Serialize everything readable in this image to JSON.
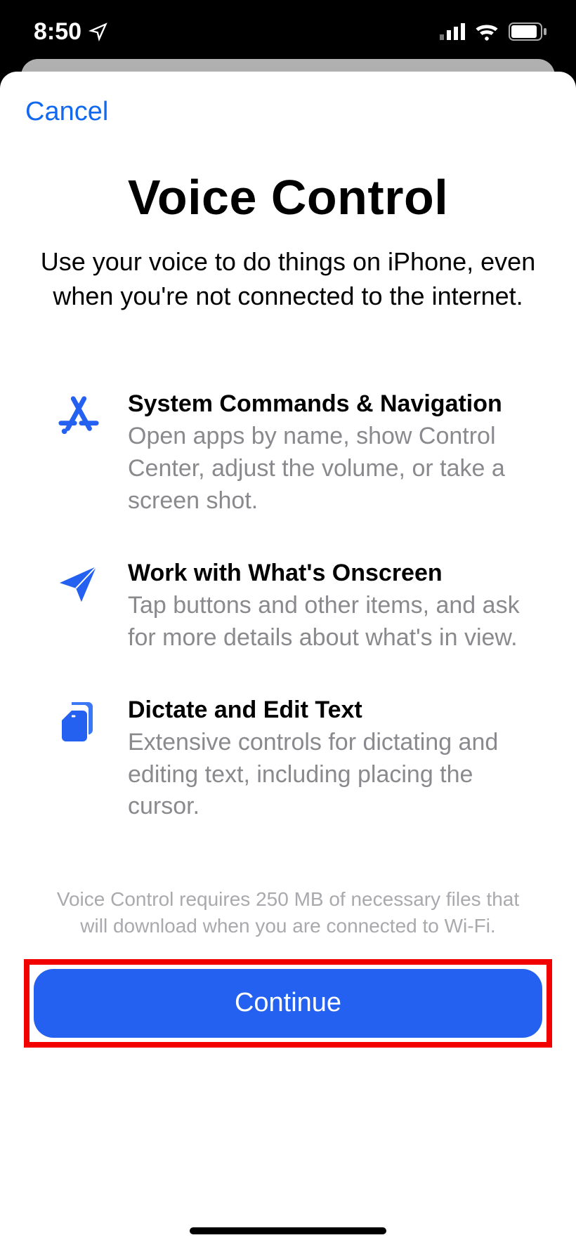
{
  "status": {
    "time": "8:50"
  },
  "sheet": {
    "cancel": "Cancel",
    "title": "Voice Control",
    "subtitle": "Use your voice to do things on iPhone, even when you're not connected to the internet.",
    "features": [
      {
        "title": "System Commands & Navigation",
        "desc": "Open apps by name, show Control Center, adjust the volume, or take a screen shot."
      },
      {
        "title": "Work with What's Onscreen",
        "desc": "Tap buttons and other items, and ask for more details about what's in view."
      },
      {
        "title": "Dictate and Edit Text",
        "desc": "Extensive controls for dictating and editing text, including placing the cursor."
      }
    ],
    "footer": "Voice Control requires 250 MB of necessary files that will download when you are connected to Wi-Fi.",
    "continue": "Continue"
  }
}
